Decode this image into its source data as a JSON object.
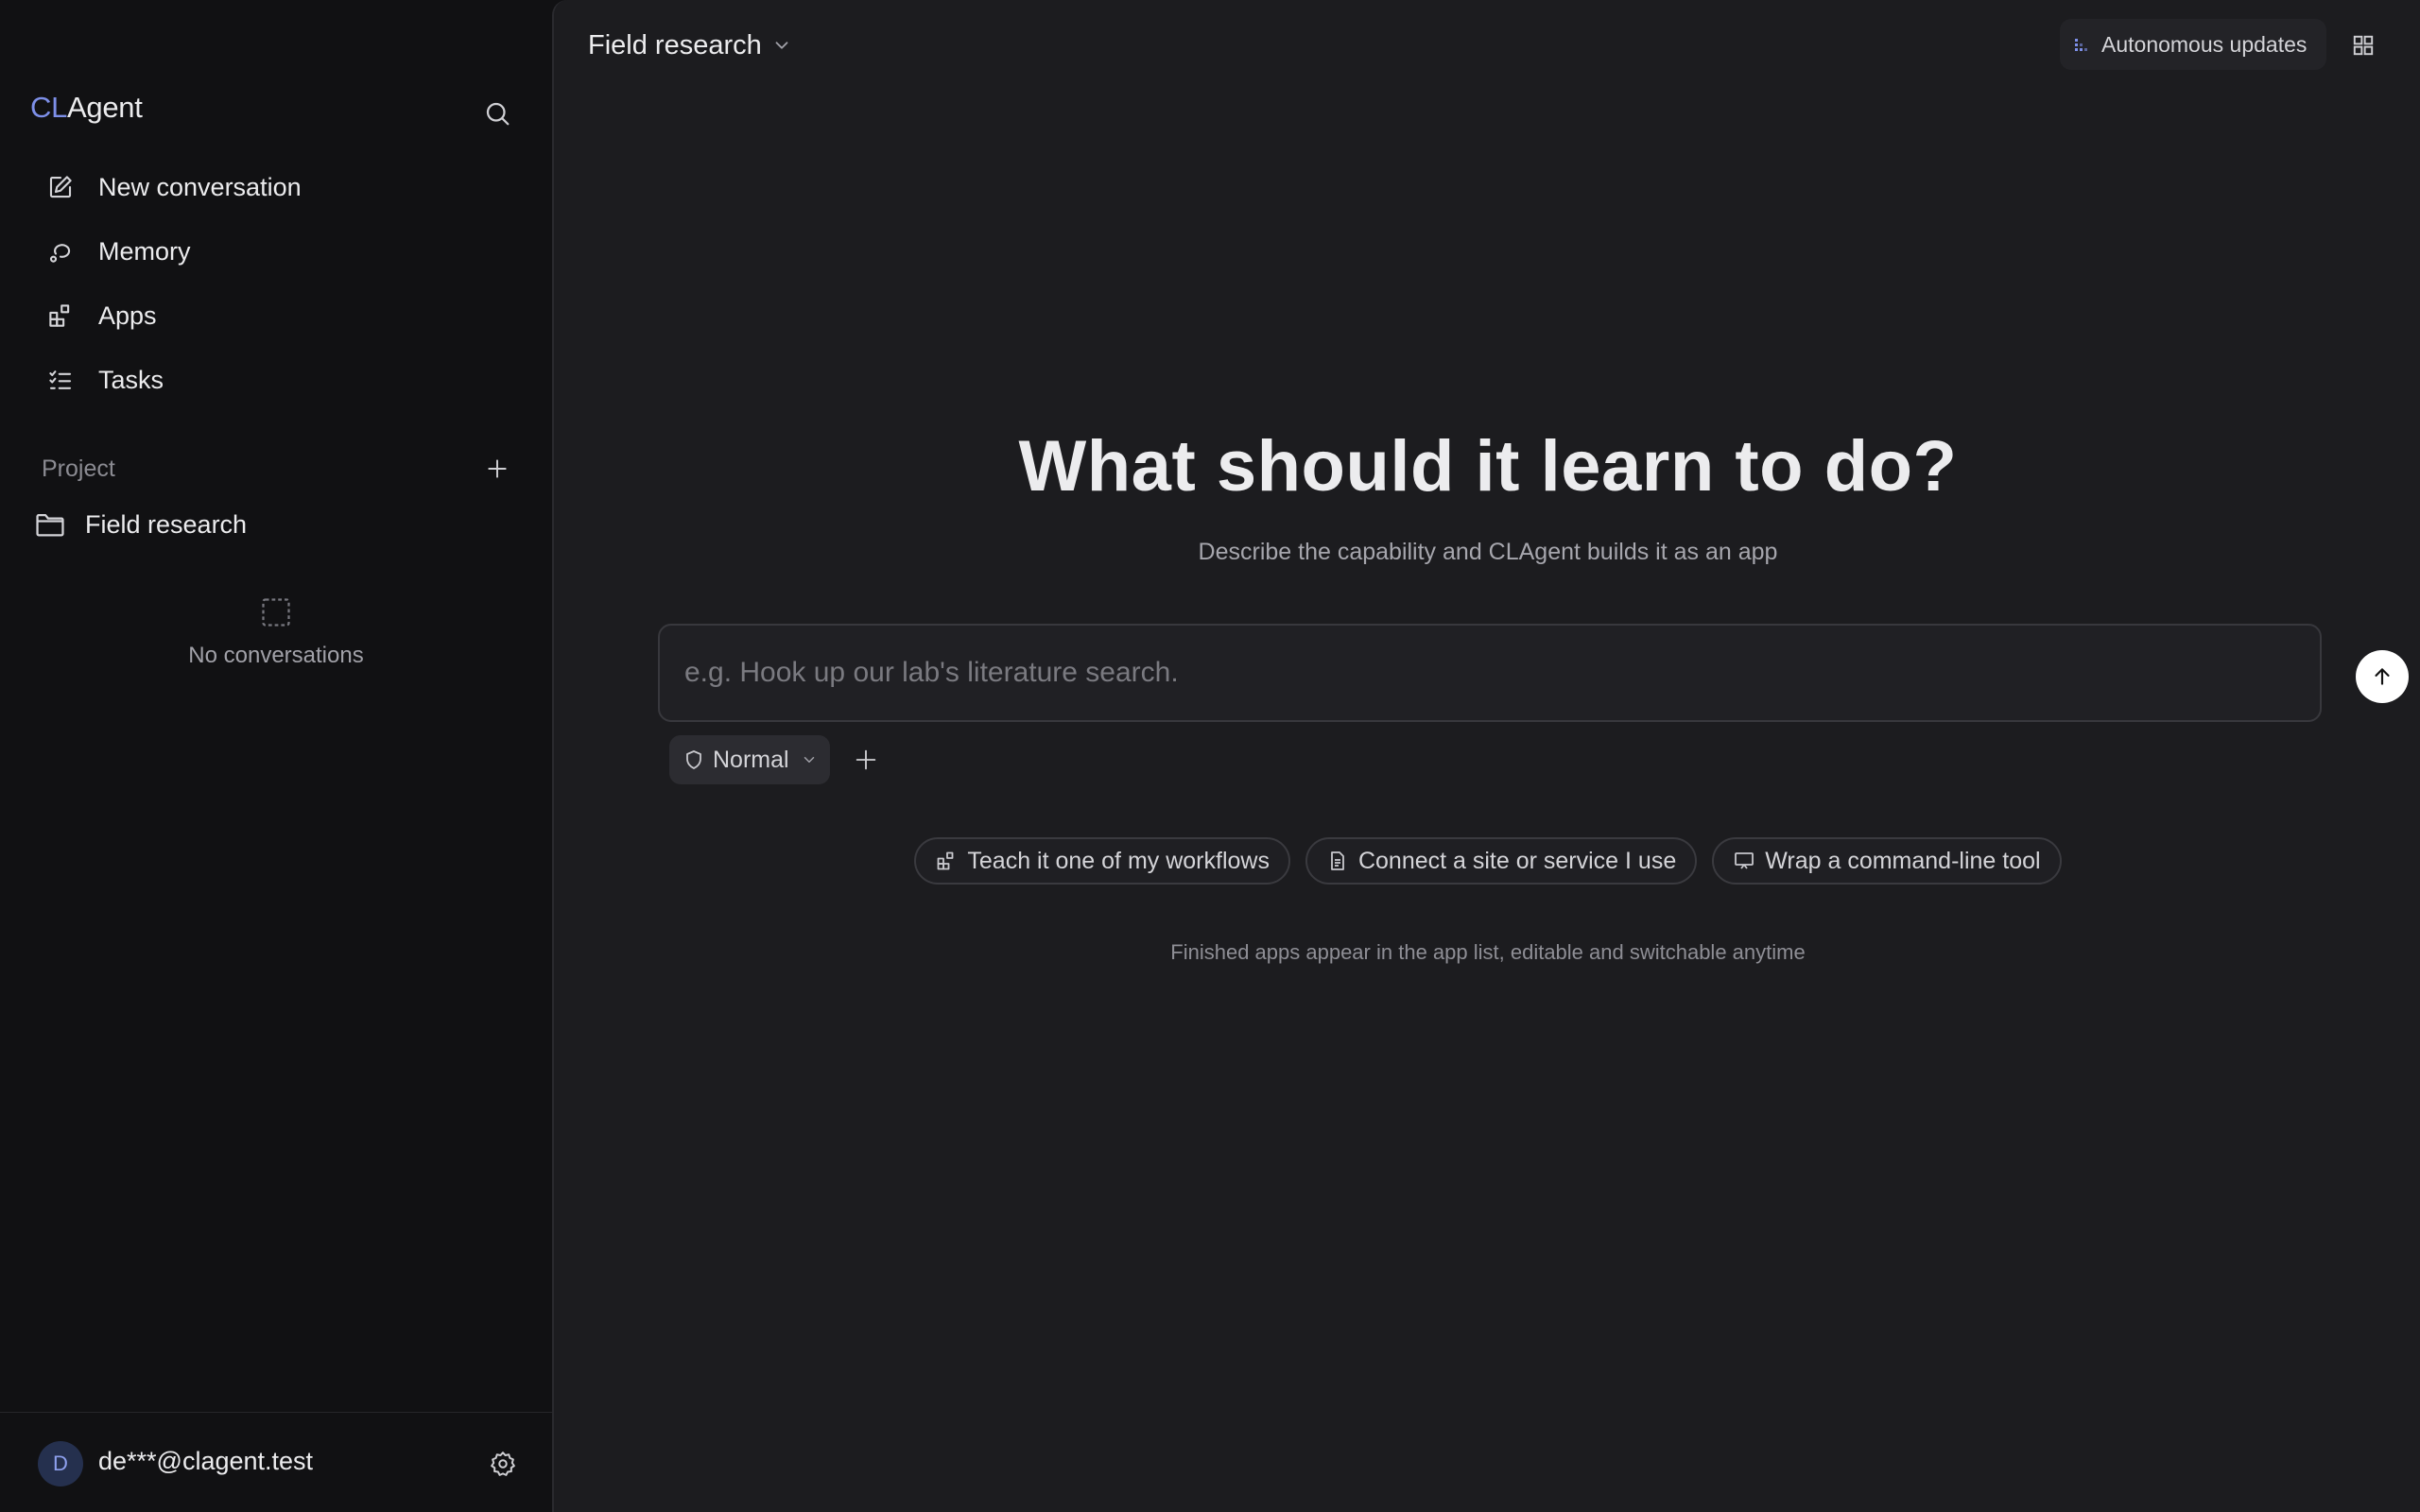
{
  "app": {
    "logo_prefix": "CL",
    "logo_suffix": "Agent"
  },
  "sidebar": {
    "nav": [
      {
        "label": "New conversation",
        "icon": "edit-icon"
      },
      {
        "label": "Memory",
        "icon": "memory-icon"
      },
      {
        "label": "Apps",
        "icon": "apps-icon"
      },
      {
        "label": "Tasks",
        "icon": "tasks-icon"
      }
    ],
    "section_label": "Project",
    "project": {
      "label": "Field research",
      "icon": "folder-icon"
    },
    "empty_text": "No conversations",
    "user": {
      "initial": "D",
      "email": "de***@clagent.test"
    }
  },
  "topbar": {
    "project_label": "Field research",
    "autonomous_label": "Autonomous updates"
  },
  "hero": {
    "title": "What should it learn to do?",
    "subtitle": "Describe the capability and CLAgent builds it as an app"
  },
  "composer": {
    "value": "",
    "placeholder": "e.g. Hook up our lab's literature search.",
    "mode_label": "Normal"
  },
  "chips": [
    {
      "label": "Teach it one of my workflows",
      "icon": "apps-icon"
    },
    {
      "label": "Connect a site or service I use",
      "icon": "document-icon"
    },
    {
      "label": "Wrap a command-line tool",
      "icon": "monitor-icon"
    }
  ],
  "hint": "Finished apps appear in the app list, editable and switchable anytime",
  "colors": {
    "accent": "#7d8fe8",
    "sidebar_bg": "#111113",
    "main_bg": "#1c1c1f"
  }
}
